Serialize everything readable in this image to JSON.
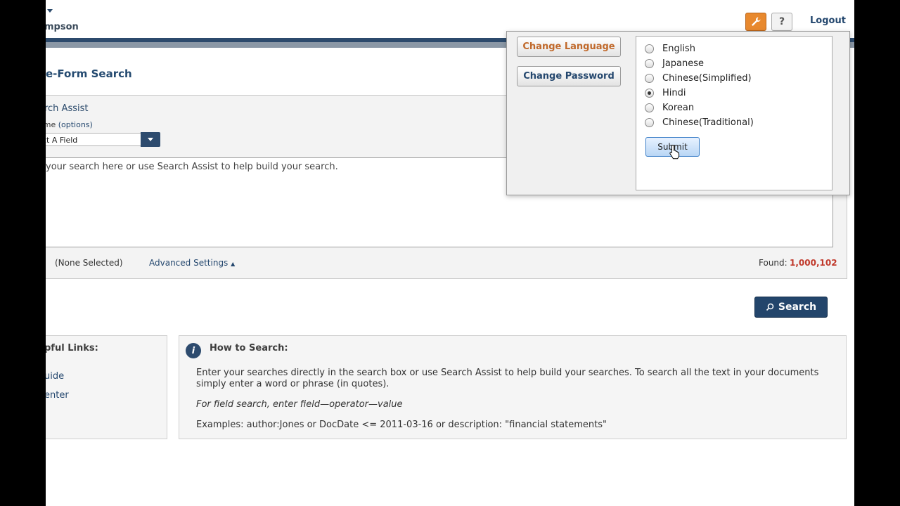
{
  "header": {
    "user_name": "mpson",
    "help_label": "?",
    "logout_label": "Logout"
  },
  "page_title": "e-Form Search",
  "search_assist": {
    "title": "arch Assist",
    "name_label": "ame",
    "name_options": "(options)",
    "field_select_value": "ct A Field",
    "placeholder": "your search here or use Search Assist to help build your search."
  },
  "status": {
    "none_selected": "(None Selected)",
    "advanced_settings": "Advanced Settings",
    "found_label": "Found:",
    "found_count": "1,000,102"
  },
  "search_button": "Search",
  "helpful_links": {
    "title": "pful Links:",
    "items": [
      "uide",
      "enter"
    ]
  },
  "how_to": {
    "title": "How to Search:",
    "p1": "Enter your searches directly in the search box or use Search Assist to help build your searches. To search all the text in your documents simply enter a word or phrase (in quotes).",
    "p2": "For field search, enter field—operator—value",
    "p3": "Examples: author:Jones or DocDate <= 2011-03-16 or description: \"financial statements\""
  },
  "popup": {
    "change_language": "Change Language",
    "change_password": "Change Password",
    "languages": [
      {
        "label": "English",
        "selected": false
      },
      {
        "label": "Japanese",
        "selected": false
      },
      {
        "label": "Chinese(Simplified)",
        "selected": false
      },
      {
        "label": "Hindi",
        "selected": true
      },
      {
        "label": "Korean",
        "selected": false
      },
      {
        "label": "Chinese(Traditional)",
        "selected": false
      }
    ],
    "submit": "Submit"
  }
}
